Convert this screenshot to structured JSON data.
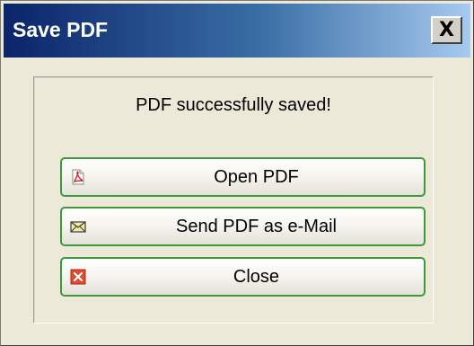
{
  "window": {
    "title": "Save PDF",
    "close_glyph": "X"
  },
  "message": "PDF successfully saved!",
  "buttons": [
    {
      "label": "Open PDF",
      "icon": "pdf-file-icon"
    },
    {
      "label": "Send PDF as e-Mail",
      "icon": "envelope-icon"
    },
    {
      "label": "Close",
      "icon": "red-x-icon"
    }
  ],
  "colors": {
    "title_gradient_start": "#0a246a",
    "title_gradient_end": "#a6caf0",
    "button_border": "#3c9a3c",
    "dialog_background": "#ece9d8"
  }
}
